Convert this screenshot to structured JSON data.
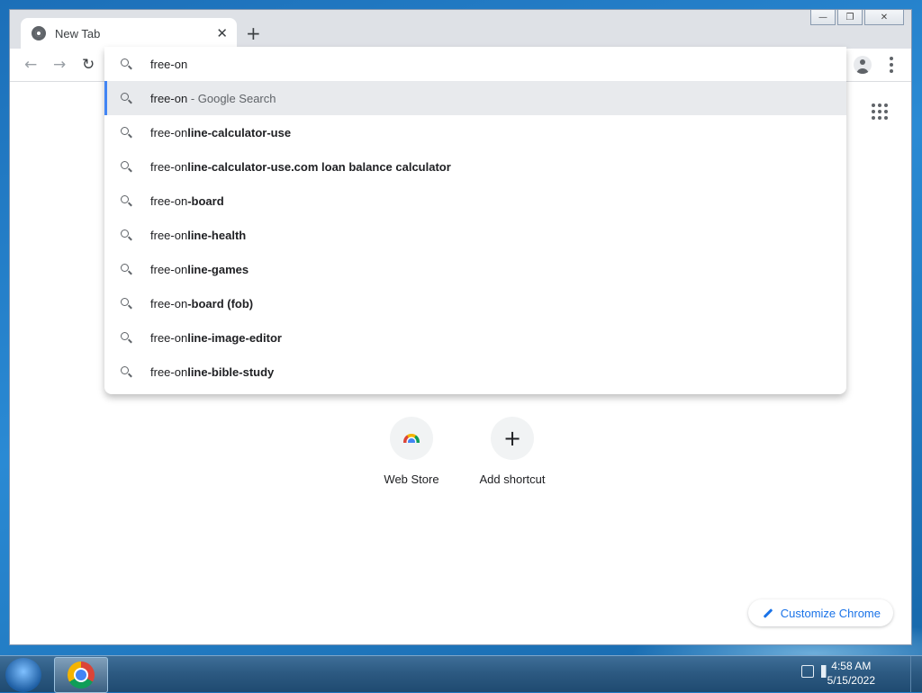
{
  "browser": {
    "tab_title": "New Tab",
    "window_controls": [
      "minimize",
      "restore",
      "close"
    ]
  },
  "omnibox": {
    "value": "free-on",
    "suggestions": [
      {
        "typed": "free-on",
        "rest": "",
        "suffix": " - Google Search"
      },
      {
        "typed": "free-on",
        "rest": "line-calculator-use",
        "suffix": ""
      },
      {
        "typed": "free-on",
        "rest": "line-calculator-use.com loan balance calculator",
        "suffix": ""
      },
      {
        "typed": "free-on",
        "rest": "-board",
        "suffix": ""
      },
      {
        "typed": "free-on",
        "rest": "line-health",
        "suffix": ""
      },
      {
        "typed": "free-on",
        "rest": "line-games",
        "suffix": ""
      },
      {
        "typed": "free-on",
        "rest": "-board (fob)",
        "suffix": ""
      },
      {
        "typed": "free-on",
        "rest": "line-image-editor",
        "suffix": ""
      },
      {
        "typed": "free-on",
        "rest": "line-bible-study",
        "suffix": ""
      }
    ]
  },
  "shortcuts": [
    {
      "label": "Web Store",
      "icon": "chrome-web-store-icon"
    },
    {
      "label": "Add shortcut",
      "icon": "plus-icon"
    }
  ],
  "customize_label": "Customize Chrome",
  "taskbar": {
    "time": "4:58 AM",
    "date": "5/15/2022"
  },
  "colors": {
    "accent": "#1a73e8",
    "selected_row": "#e8eaed",
    "selected_bar": "#4285f4"
  }
}
